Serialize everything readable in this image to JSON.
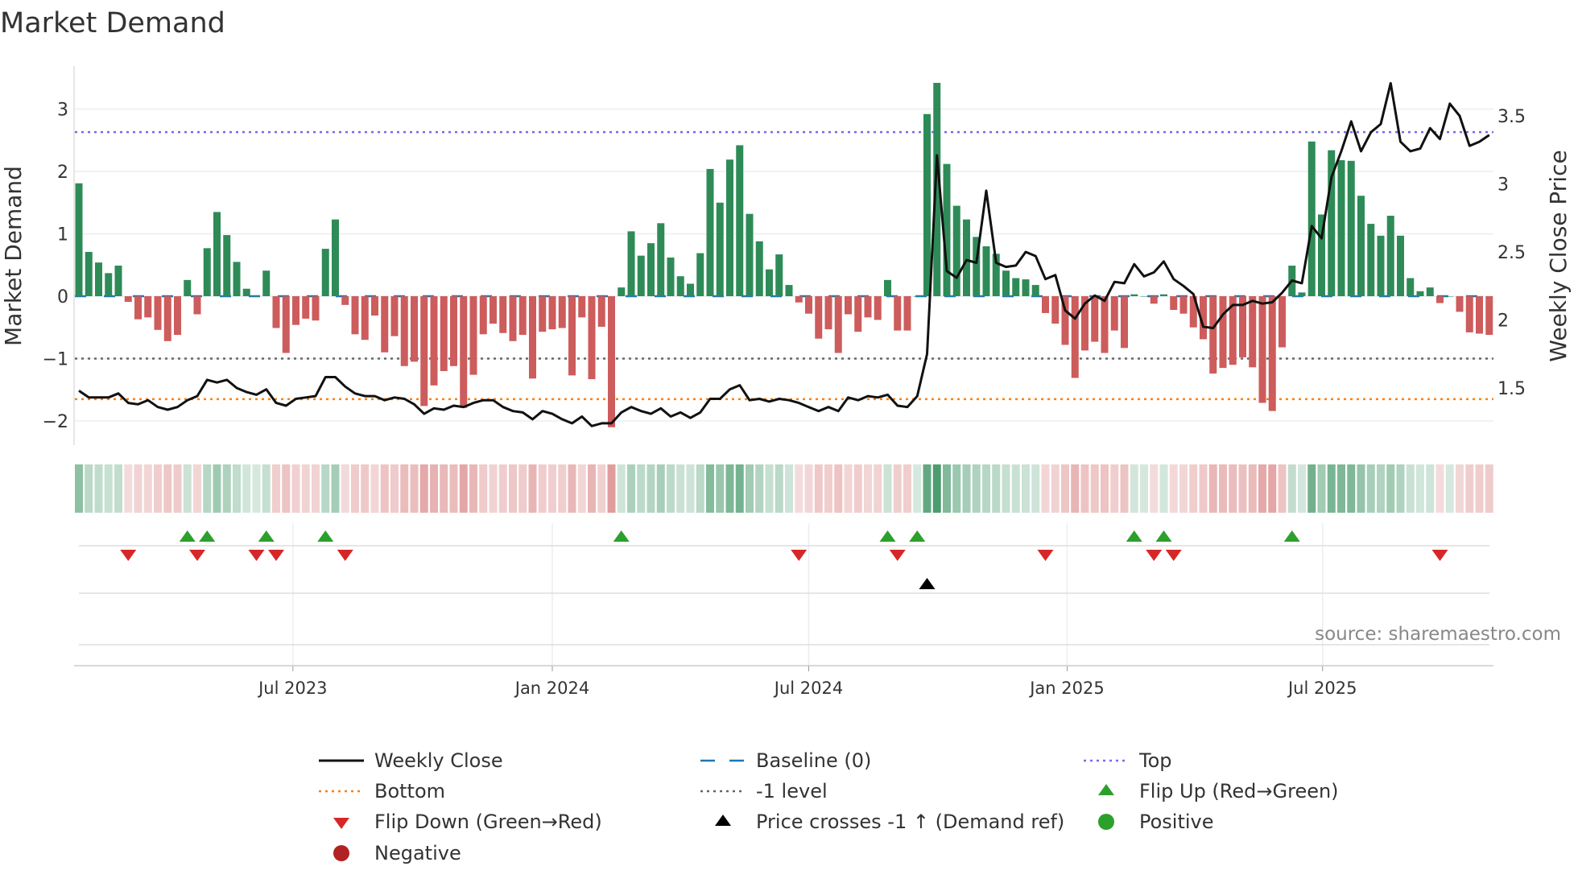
{
  "chart_data": {
    "type": "bar",
    "title": "Market Demand",
    "ylabel": "Market Demand",
    "y2label": "Weekly Close Price",
    "x_unit": "week index",
    "ylim": [
      -2.38,
      3.7
    ],
    "y2lim": [
      1.08,
      3.87
    ],
    "yticks": [
      {
        "v": -2,
        "label": "−2"
      },
      {
        "v": -1,
        "label": "−1"
      },
      {
        "v": 0,
        "label": "0"
      },
      {
        "v": 1,
        "label": "1"
      },
      {
        "v": 2,
        "label": "2"
      },
      {
        "v": 3,
        "label": "3"
      }
    ],
    "y2ticks": [
      {
        "v": 1.5,
        "label": "1.5"
      },
      {
        "v": 2,
        "label": "2"
      },
      {
        "v": 2.5,
        "label": "2.5"
      },
      {
        "v": 3,
        "label": "3"
      },
      {
        "v": 3.5,
        "label": "3.5"
      }
    ],
    "xticks": [
      {
        "w": 21.7,
        "label": "Jul 2023"
      },
      {
        "w": 48.0,
        "label": "Jan 2024"
      },
      {
        "w": 74.0,
        "label": "Jul 2024"
      },
      {
        "w": 100.2,
        "label": "Jan 2025"
      },
      {
        "w": 126.1,
        "label": "Jul 2025"
      }
    ],
    "levels": {
      "top": 2.63,
      "bottom": -1.65,
      "minus_one": -1,
      "baseline": 0
    },
    "demand": [
      1.81,
      0.71,
      0.54,
      0.37,
      0.49,
      -0.09,
      -0.37,
      -0.34,
      -0.54,
      -0.72,
      -0.62,
      0.26,
      -0.29,
      0.77,
      1.35,
      0.98,
      0.55,
      0.12,
      0,
      0.41,
      -0.51,
      -0.91,
      -0.46,
      -0.36,
      -0.39,
      0.76,
      1.23,
      -0.14,
      -0.61,
      -0.7,
      -0.31,
      -0.9,
      -0.64,
      -1.12,
      -1.05,
      -1.76,
      -1.43,
      -1.2,
      -1.12,
      -1.79,
      -1.26,
      -0.61,
      -0.44,
      -0.59,
      -0.72,
      -0.62,
      -1.32,
      -0.57,
      -0.53,
      -0.51,
      -1.27,
      -0.34,
      -1.33,
      -0.49,
      -2.1,
      0.14,
      1.04,
      0.65,
      0.85,
      1.17,
      0.62,
      0.32,
      0.2,
      0.69,
      2.04,
      1.5,
      2.19,
      2.42,
      1.32,
      0.88,
      0.43,
      0.67,
      0.18,
      -0.1,
      -0.28,
      -0.68,
      -0.53,
      -0.91,
      -0.29,
      -0.57,
      -0.34,
      -0.38,
      0.26,
      -0.55,
      -0.55,
      0,
      2.92,
      3.42,
      2.12,
      1.45,
      1.23,
      0.95,
      0.8,
      0.68,
      0.41,
      0.29,
      0.27,
      0.18,
      -0.27,
      -0.44,
      -0.78,
      -1.31,
      -0.87,
      -0.73,
      -0.91,
      -0.55,
      -0.83,
      0.03,
      0,
      -0.12,
      0.03,
      -0.22,
      -0.28,
      -0.5,
      -0.69,
      -1.24,
      -1.15,
      -1.1,
      -0.98,
      -1.14,
      -1.71,
      -1.84,
      -0.82,
      0.49,
      0.06,
      2.48,
      1.31,
      2.34,
      2.18,
      2.17,
      1.61,
      1.16,
      0.97,
      1.29,
      0.97,
      0.29,
      0.08,
      0.14,
      -0.11,
      0,
      -0.25,
      -0.58,
      -0.6,
      -0.62
    ],
    "weekly_close": [
      1.48,
      1.43,
      1.43,
      1.43,
      1.46,
      1.39,
      1.38,
      1.41,
      1.36,
      1.34,
      1.36,
      1.41,
      1.44,
      1.56,
      1.54,
      1.56,
      1.5,
      1.47,
      1.45,
      1.49,
      1.39,
      1.37,
      1.42,
      1.43,
      1.44,
      1.58,
      1.58,
      1.51,
      1.46,
      1.44,
      1.44,
      1.41,
      1.43,
      1.42,
      1.38,
      1.31,
      1.35,
      1.34,
      1.37,
      1.36,
      1.39,
      1.41,
      1.41,
      1.36,
      1.33,
      1.32,
      1.27,
      1.33,
      1.31,
      1.27,
      1.24,
      1.29,
      1.22,
      1.24,
      1.24,
      1.32,
      1.36,
      1.33,
      1.31,
      1.35,
      1.29,
      1.32,
      1.28,
      1.32,
      1.42,
      1.42,
      1.49,
      1.52,
      1.41,
      1.42,
      1.4,
      1.42,
      1.41,
      1.39,
      1.36,
      1.33,
      1.36,
      1.33,
      1.43,
      1.41,
      1.44,
      1.43,
      1.45,
      1.37,
      1.36,
      1.44,
      1.75,
      3.21,
      2.36,
      2.31,
      2.44,
      2.42,
      2.95,
      2.42,
      2.39,
      2.4,
      2.5,
      2.47,
      2.3,
      2.33,
      2.07,
      2.01,
      2.12,
      2.18,
      2.14,
      2.28,
      2.27,
      2.41,
      2.32,
      2.35,
      2.43,
      2.3,
      2.25,
      2.19,
      1.95,
      1.94,
      2.04,
      2.11,
      2.11,
      2.14,
      2.12,
      2.13,
      2.2,
      2.29,
      2.27,
      2.69,
      2.6,
      3.05,
      3.24,
      3.46,
      3.24,
      3.38,
      3.44,
      3.74,
      3.31,
      3.24,
      3.26,
      3.41,
      3.33,
      3.59,
      3.5,
      3.28,
      3.31,
      3.36
    ],
    "flip_up_weeks": [
      11,
      13,
      19,
      25,
      55,
      82,
      85,
      107,
      110,
      123
    ],
    "flip_down_weeks": [
      5,
      12,
      18,
      20,
      27,
      73,
      83,
      98,
      109,
      111,
      138
    ],
    "price_cross_weeks": [
      86
    ],
    "legend": [
      {
        "key": "close",
        "label": "Weekly Close"
      },
      {
        "key": "baseline",
        "label": "Baseline (0)"
      },
      {
        "key": "top",
        "label": "Top"
      },
      {
        "key": "bottom",
        "label": "Bottom"
      },
      {
        "key": "minus1",
        "label": "-1 level"
      },
      {
        "key": "flipup",
        "label": "Flip Up (Red→Green)"
      },
      {
        "key": "flipdown",
        "label": "Flip Down (Green→Red)"
      },
      {
        "key": "cross",
        "label": "Price crosses -1 ↑ (Demand ref)"
      },
      {
        "key": "positive",
        "label": "Positive"
      },
      {
        "key": "negative",
        "label": "Negative"
      }
    ],
    "legend_placement": "bottom",
    "source": "source: sharemaestro.com"
  },
  "colors": {
    "positive": "#2e8b57",
    "negative": "#cd5c5c",
    "baseline": "#1f77b4",
    "top": "#7b68ee",
    "bottom": "#ff7f0e",
    "minus_one": "#666666",
    "flip_up": "#2ca02c",
    "flip_down": "#d62728",
    "cross": "#000000",
    "negative_dot": "#b22222",
    "close": "#111111"
  }
}
